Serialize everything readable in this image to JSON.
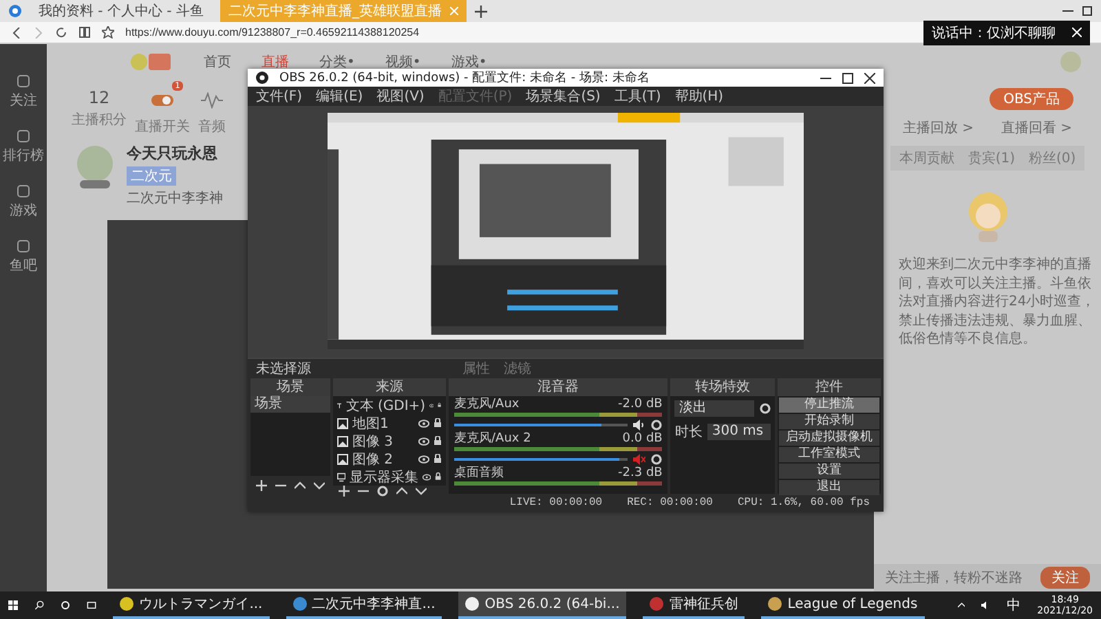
{
  "browser": {
    "tabs": [
      {
        "title": "我的资料 - 个人中心 - 斗鱼",
        "selected": false
      },
      {
        "title": "二次元中李李神直播_英雄联盟直播",
        "selected": true
      }
    ],
    "url": "https://www.douyu.com/91238807_r=0.46592114388120254",
    "toast": "说话中：仅浏不聊聊"
  },
  "site": {
    "nav": [
      {
        "label": "首页",
        "selected": false
      },
      {
        "label": "直播",
        "selected": true
      },
      {
        "label": "分类•",
        "selected": false
      },
      {
        "label": "视频•",
        "selected": false
      },
      {
        "label": "游戏•",
        "selected": false
      }
    ],
    "sidebar": [
      "关注",
      "排行榜",
      "游戏",
      "鱼吧"
    ],
    "stats": [
      {
        "value": "12",
        "label": "主播积分"
      },
      {
        "label": "直播开关",
        "badge": "1"
      },
      {
        "label": "音频"
      }
    ],
    "room_title": "今天只玩永恩",
    "anchor": "二次元中李李神",
    "tag": "二次元",
    "obs_button": "OBS产品",
    "notices": [
      "主播回放 >",
      "直播回看 >"
    ],
    "rank_tabs": [
      {
        "label": "本周贡献",
        "selected": false
      },
      {
        "label": "贵宾(1)",
        "selected": false
      },
      {
        "label": "粉丝(0)",
        "selected": false
      }
    ],
    "notice_text": "欢迎来到二次元中李李神的直播间，喜欢可以关注主播。斗鱼依法对直播内容进行24小时巡查，禁止传播违法违规、暴力血腥、低俗色情等不良信息。",
    "follow_hint": "关注主播，转粉不迷路",
    "follow_button": "关注"
  },
  "obs": {
    "title": "OBS 26.0.2 (64-bit, windows) - 配置文件: 未命名 - 场景: 未命名",
    "menu": [
      {
        "label": "文件(F)",
        "disabled": false
      },
      {
        "label": "编辑(E)",
        "disabled": false
      },
      {
        "label": "视图(V)",
        "disabled": false
      },
      {
        "label": "配置文件(P)",
        "disabled": true
      },
      {
        "label": "场景集合(S)",
        "disabled": false
      },
      {
        "label": "工具(T)",
        "disabled": false
      },
      {
        "label": "帮助(H)",
        "disabled": false
      }
    ],
    "source_bar": "未选择源",
    "source_buttons": [
      {
        "label": "属性",
        "disabled": true
      },
      {
        "label": "滤镜",
        "disabled": true
      }
    ],
    "docks": [
      "场景",
      "来源",
      "混音器",
      "转场特效",
      "控件"
    ],
    "scenes": [
      {
        "name": "场景",
        "selected": true
      }
    ],
    "sources": [
      {
        "kind": "text",
        "name": "文本 (GDI+)"
      },
      {
        "kind": "image",
        "name": "地图1"
      },
      {
        "kind": "image",
        "name": "图像 3"
      },
      {
        "kind": "image",
        "name": "图像 2"
      },
      {
        "kind": "monitor",
        "name": "显示器采集"
      }
    ],
    "channels": [
      {
        "name": "麦克风/Aux",
        "reading": "-2.0 dB",
        "level": 0.85,
        "muted": false
      },
      {
        "name": "麦克风/Aux 2",
        "reading": "0.0 dB",
        "level": 0.95,
        "muted": true
      },
      {
        "name": "桌面音频",
        "reading": "-2.3 dB"
      }
    ],
    "transition": "淡出",
    "duration_label": "时长",
    "duration": "300 ms",
    "controls": [
      {
        "label": "停止推流",
        "selected": true
      },
      {
        "label": "开始录制",
        "selected": false
      },
      {
        "label": "启动虚拟摄像机",
        "selected": false
      },
      {
        "label": "工作室模式",
        "selected": false
      },
      {
        "label": "设置",
        "selected": false
      },
      {
        "label": "退出",
        "selected": false
      }
    ],
    "status": [
      "LIVE: 00:00:00",
      "REC: 00:00:00",
      "CPU: 1.6%, 60.00 fps"
    ]
  },
  "taskbar": {
    "apps": [
      {
        "label": "ウルトラマンガイ...",
        "selected": false
      },
      {
        "label": "二次元中李李神直...",
        "selected": false
      },
      {
        "label": "OBS 26.0.2 (64-bi...",
        "selected": true
      },
      {
        "label": "雷神征兵创",
        "selected": false
      },
      {
        "label": "League of Legends",
        "selected": false
      }
    ],
    "ime": "中",
    "time": "18:49",
    "date": "2021/12/20"
  }
}
